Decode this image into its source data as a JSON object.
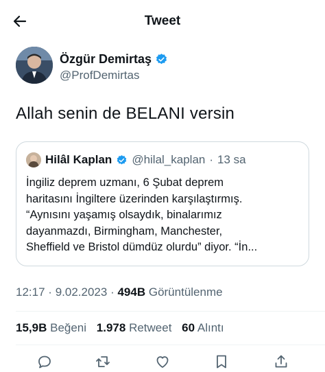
{
  "header": {
    "title": "Tweet",
    "back_icon": "arrow-left-icon"
  },
  "tweet": {
    "author_name": "Özgür Demirtaş",
    "author_handle": "@ProfDemirtas",
    "verified_color": "#1d9bf0",
    "text": "Allah senin de BELANI versin"
  },
  "quoted": {
    "name": "Hilâl Kaplan",
    "handle": "@hilal_kaplan",
    "sep": "·",
    "time": "13 sa",
    "body_lines": [
      "İngiliz deprem uzmanı, 6 Şubat deprem",
      "haritasını İngiltere üzerinden karşılaştırmış.",
      "“Aynısını yaşamış olsaydık, binalarımız",
      "dayanmazdı, Birmingham, Manchester,",
      "Sheffield ve Bristol dümdüz olurdu” diyor. “İn..."
    ]
  },
  "meta": {
    "time": "12:17",
    "date": "9.02.2023",
    "sep": "·",
    "views_count": "494B",
    "views_label": "Görüntülenme"
  },
  "stats": {
    "likes_count": "15,9B",
    "likes_label": "Beğeni",
    "retweets_count": "1.978",
    "retweets_label": "Retweet",
    "quotes_count": "60",
    "quotes_label": "Alıntı"
  },
  "actions": [
    "reply-icon",
    "retweet-icon",
    "like-icon",
    "bookmark-icon",
    "share-icon"
  ],
  "colors": {
    "text": "#0f1419",
    "secondary": "#536471",
    "border": "#cfd9de",
    "accent": "#1d9bf0"
  }
}
